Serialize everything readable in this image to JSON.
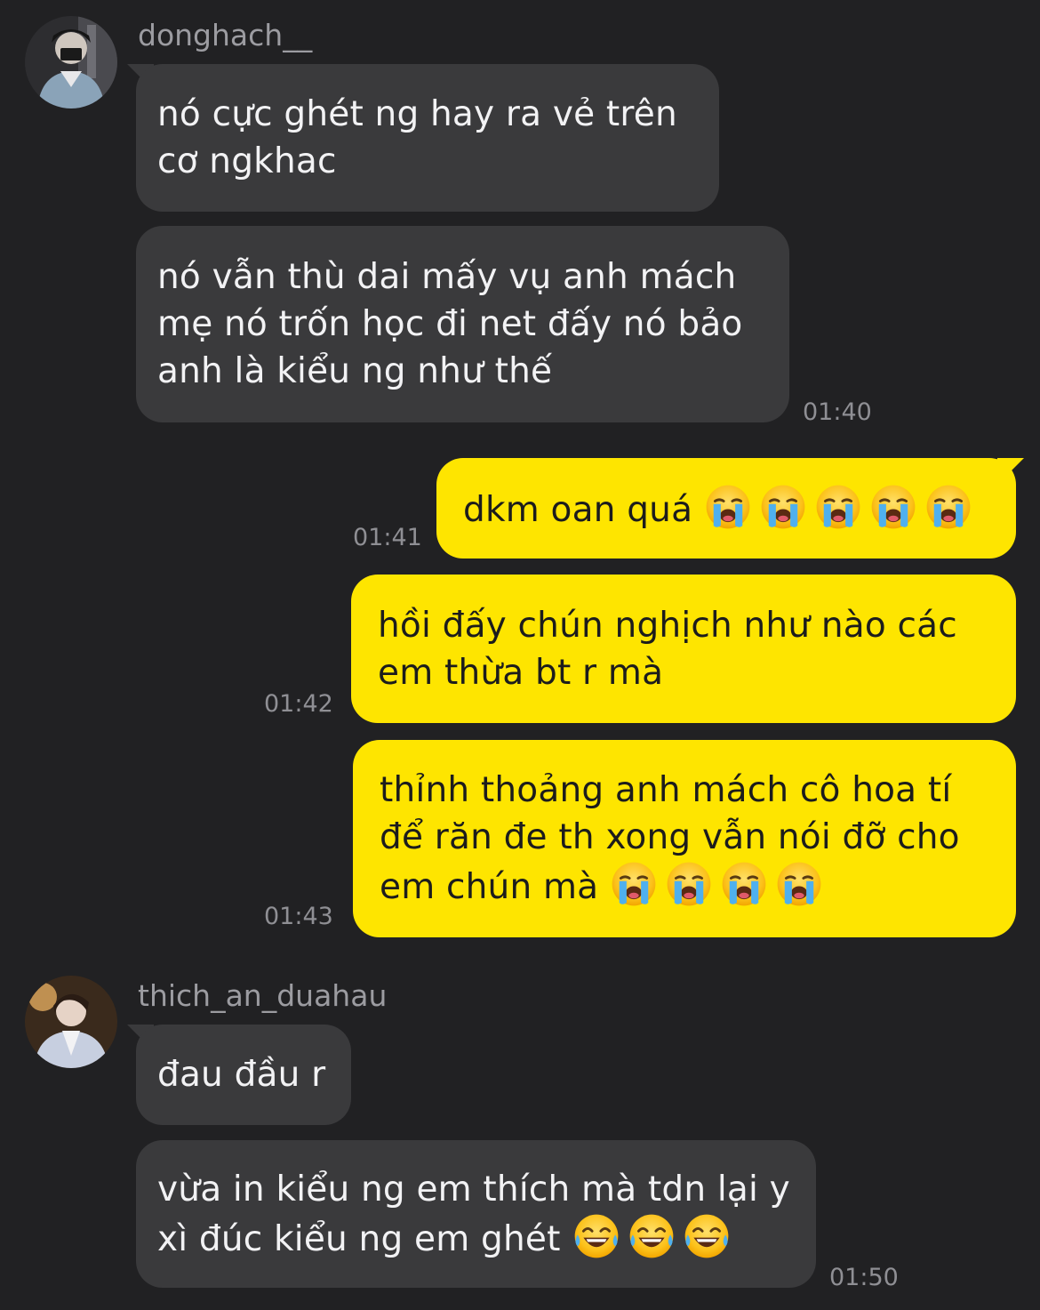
{
  "thread": [
    {
      "sender": "donghach__",
      "messages": [
        {
          "lines": [
            "nó cực ghét ng hay ra vẻ trên",
            "cơ ngkhac"
          ]
        },
        {
          "lines": [
            "nó vẫn thù dai mấy vụ anh mách",
            "mẹ nó trốn học đi net đấy nó bảo",
            "anh là kiểu ng như thế"
          ],
          "time": "01:40"
        }
      ]
    },
    {
      "sender": "me",
      "messages": [
        {
          "lines": [
            "dkm oan quá"
          ],
          "emoji": "loudly-crying-face",
          "emoji_count": 5,
          "time": "01:41"
        },
        {
          "lines": [
            "hồi đấy chún nghịch như nào các",
            "em thừa bt r mà"
          ],
          "time": "01:42"
        },
        {
          "lines": [
            "thỉnh thoảng anh mách cô hoa tí",
            "để răn đe th xong vẫn nói đỡ cho",
            "em chún mà"
          ],
          "emoji": "loudly-crying-face",
          "emoji_count": 4,
          "time": "01:43"
        }
      ]
    },
    {
      "sender": "thich_an_duahau",
      "messages": [
        {
          "lines": [
            "đau đầu r"
          ]
        },
        {
          "lines": [
            "vừa in kiểu ng em thích mà tdn lại y",
            "xì đúc kiểu ng em ghét"
          ],
          "emoji": "face-with-tears-of-joy",
          "emoji_count": 3,
          "time": "01:50"
        }
      ]
    }
  ],
  "colors": {
    "background": "#212123",
    "incoming_bubble": "#3a3a3c",
    "outgoing_bubble": "#fee500",
    "timestamp": "#8f8f94",
    "sender_name": "#9c9ca1"
  }
}
